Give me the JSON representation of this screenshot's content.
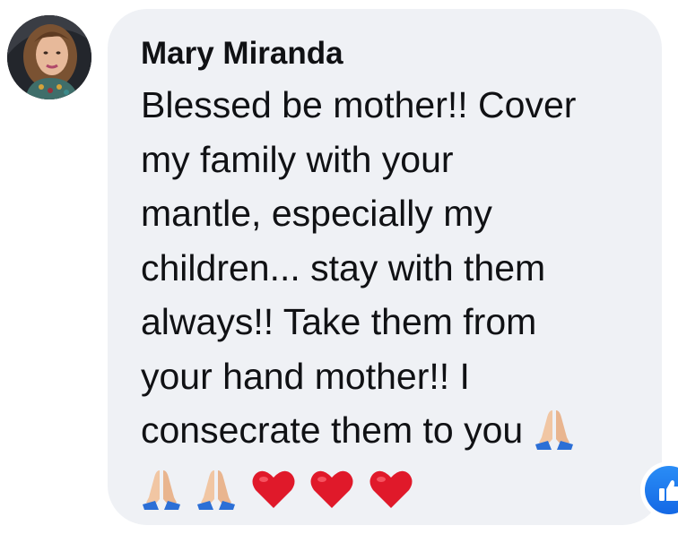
{
  "comment": {
    "author": "Mary Miranda",
    "lines": [
      "Blessed be mother!! Cover",
      "my family with your",
      "mantle, especially my",
      "children... stay with them",
      "always!! Take them from",
      "your hand mother!! I",
      "consecrate them to you"
    ],
    "emojis": [
      "folded-hands",
      "folded-hands",
      "folded-hands",
      "red-heart",
      "red-heart",
      "red-heart"
    ]
  },
  "reaction": {
    "type": "like",
    "icon": "thumbs-up-icon",
    "color": "#1877f2"
  },
  "colors": {
    "bubble": "#eff1f5",
    "text": "#101114",
    "heart": "#e0192a",
    "like": "#1877f2"
  }
}
